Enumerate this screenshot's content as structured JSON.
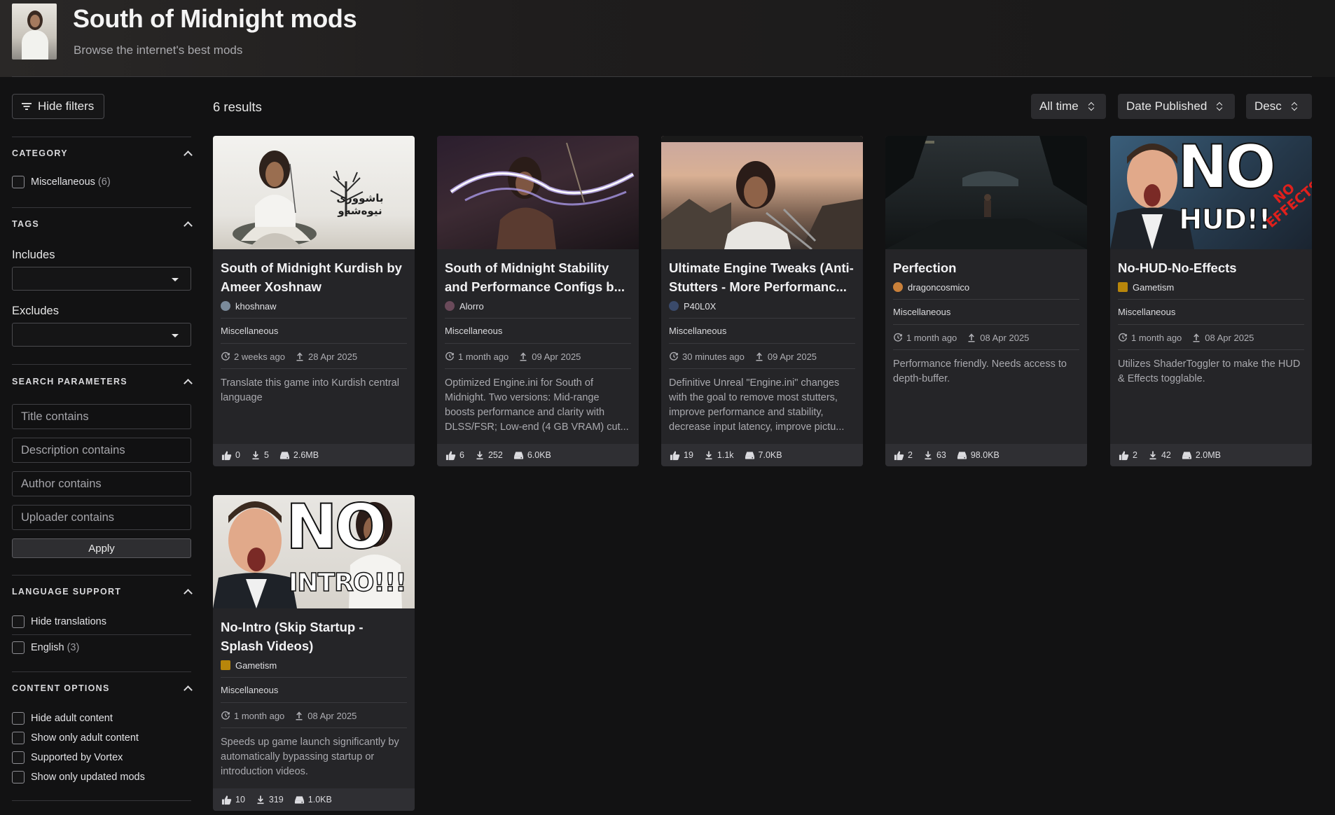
{
  "header": {
    "title": "South of Midnight mods",
    "subtitle": "Browse the internet's best mods"
  },
  "sidebar": {
    "hide_filters_label": "Hide filters",
    "category": {
      "heading": "CATEGORY",
      "items": [
        {
          "label": "Miscellaneous",
          "count": "(6)"
        }
      ]
    },
    "tags": {
      "heading": "TAGS",
      "includes_label": "Includes",
      "excludes_label": "Excludes"
    },
    "search_parameters": {
      "heading": "SEARCH PARAMETERS",
      "title_placeholder": "Title contains",
      "description_placeholder": "Description contains",
      "author_placeholder": "Author contains",
      "uploader_placeholder": "Uploader contains",
      "apply_label": "Apply"
    },
    "language_support": {
      "heading": "LANGUAGE SUPPORT",
      "hide_translations_label": "Hide translations",
      "english_label": "English",
      "english_count": "(3)"
    },
    "content_options": {
      "heading": "CONTENT OPTIONS",
      "items": [
        "Hide adult content",
        "Show only adult content",
        "Supported by Vortex",
        "Show only updated mods"
      ]
    }
  },
  "results": {
    "count_label": "6 results",
    "time_filter": "All time",
    "sort_by": "Date Published",
    "sort_order": "Desc"
  },
  "mods": [
    {
      "title": "South of Midnight Kurdish by Ameer Xoshnaw",
      "author": "khoshnaw",
      "category": "Miscellaneous",
      "updated": "2 weeks ago",
      "published": "28 Apr 2025",
      "description": "Translate this game into Kurdish central language",
      "endorsements": "0",
      "downloads": "5",
      "size": "2.6MB",
      "image_overlay": "باشووری نیوەشەو"
    },
    {
      "title": "South of Midnight Stability and Performance Configs b...",
      "author": "Alorro",
      "category": "Miscellaneous",
      "updated": "1 month ago",
      "published": "09 Apr 2025",
      "description": "Optimized Engine.ini for South of Midnight. Two versions: Mid-range boosts performance and clarity with DLSS/FSR; Low-end (4 GB VRAM) cut...",
      "endorsements": "6",
      "downloads": "252",
      "size": "6.0KB"
    },
    {
      "title": "Ultimate Engine Tweaks (Anti-Stutters - More Performanc...",
      "author": "P40L0X",
      "category": "Miscellaneous",
      "updated": "30 minutes ago",
      "published": "09 Apr 2025",
      "description": "Definitive Unreal \"Engine.ini\" changes with the goal to remove most stutters, improve performance and stability, decrease input latency, improve pictu...",
      "endorsements": "19",
      "downloads": "1.1k",
      "size": "7.0KB"
    },
    {
      "title": "Perfection",
      "author": "dragoncosmico",
      "category": "Miscellaneous",
      "updated": "1 month ago",
      "published": "08 Apr 2025",
      "description": "Performance friendly. Needs access to depth-buffer.",
      "endorsements": "2",
      "downloads": "63",
      "size": "98.0KB"
    },
    {
      "title": "No-HUD-No-Effects",
      "author": "Gametism",
      "category": "Miscellaneous",
      "updated": "1 month ago",
      "published": "08 Apr 2025",
      "description": "Utilizes ShaderToggler to make the HUD & Effects togglable.",
      "endorsements": "2",
      "downloads": "42",
      "size": "2.0MB",
      "image_text_main": "NO",
      "image_text_sub": "HUD!!",
      "image_text_corner": "NO EFFECTS"
    },
    {
      "title": "No-Intro (Skip Startup - Splash Videos)",
      "author": "Gametism",
      "category": "Miscellaneous",
      "updated": "1 month ago",
      "published": "08 Apr 2025",
      "description": "Speeds up game launch significantly by automatically bypassing startup or introduction videos.",
      "endorsements": "10",
      "downloads": "319",
      "size": "1.0KB",
      "image_text_main": "NO",
      "image_text_sub": "INTRO!!!"
    }
  ],
  "colors": {
    "background": "#121213",
    "card": "#252528",
    "card_footer": "#2f2f33",
    "text_primary": "#f2f2f4",
    "text_muted": "#a9a9ae"
  }
}
